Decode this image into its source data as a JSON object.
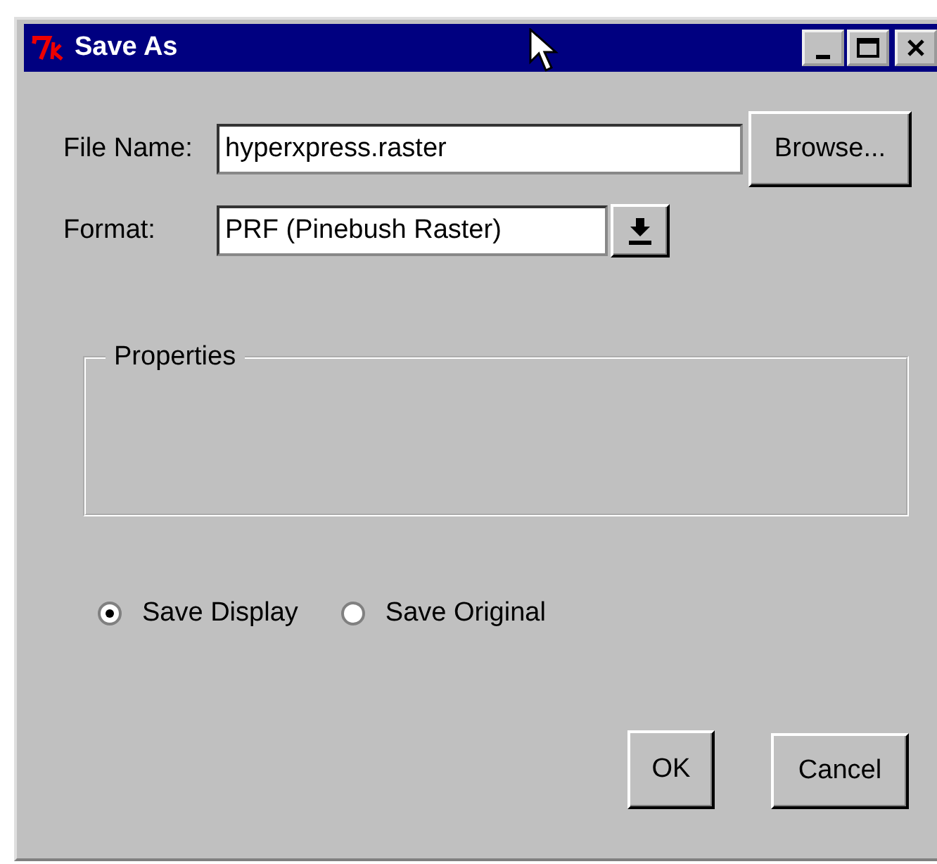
{
  "window": {
    "title": "Save As"
  },
  "file_name": {
    "label": "File Name:",
    "value": "hyperxpress.raster",
    "browse_button": "Browse..."
  },
  "format": {
    "label": "Format:",
    "value": "PRF (Pinebush Raster)"
  },
  "properties": {
    "title": "Properties"
  },
  "save_mode": [
    {
      "label": "Save Display",
      "selected": true
    },
    {
      "label": "Save Original",
      "selected": false
    }
  ],
  "buttons": [
    "OK",
    "Cancel"
  ]
}
